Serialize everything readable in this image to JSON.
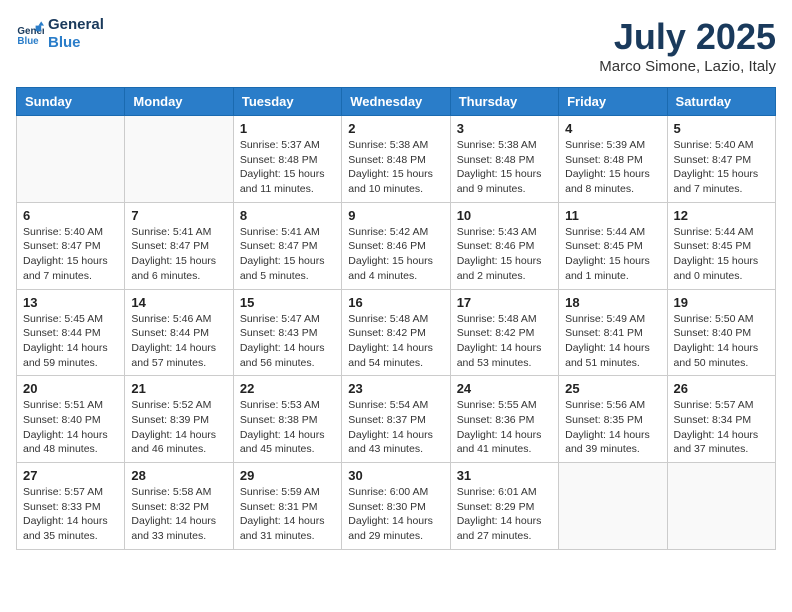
{
  "logo": {
    "text_general": "General",
    "text_blue": "Blue"
  },
  "title": "July 2025",
  "subtitle": "Marco Simone, Lazio, Italy",
  "days_of_week": [
    "Sunday",
    "Monday",
    "Tuesday",
    "Wednesday",
    "Thursday",
    "Friday",
    "Saturday"
  ],
  "weeks": [
    [
      {
        "day": "",
        "info": ""
      },
      {
        "day": "",
        "info": ""
      },
      {
        "day": "1",
        "info": "Sunrise: 5:37 AM\nSunset: 8:48 PM\nDaylight: 15 hours and 11 minutes."
      },
      {
        "day": "2",
        "info": "Sunrise: 5:38 AM\nSunset: 8:48 PM\nDaylight: 15 hours and 10 minutes."
      },
      {
        "day": "3",
        "info": "Sunrise: 5:38 AM\nSunset: 8:48 PM\nDaylight: 15 hours and 9 minutes."
      },
      {
        "day": "4",
        "info": "Sunrise: 5:39 AM\nSunset: 8:48 PM\nDaylight: 15 hours and 8 minutes."
      },
      {
        "day": "5",
        "info": "Sunrise: 5:40 AM\nSunset: 8:47 PM\nDaylight: 15 hours and 7 minutes."
      }
    ],
    [
      {
        "day": "6",
        "info": "Sunrise: 5:40 AM\nSunset: 8:47 PM\nDaylight: 15 hours and 7 minutes."
      },
      {
        "day": "7",
        "info": "Sunrise: 5:41 AM\nSunset: 8:47 PM\nDaylight: 15 hours and 6 minutes."
      },
      {
        "day": "8",
        "info": "Sunrise: 5:41 AM\nSunset: 8:47 PM\nDaylight: 15 hours and 5 minutes."
      },
      {
        "day": "9",
        "info": "Sunrise: 5:42 AM\nSunset: 8:46 PM\nDaylight: 15 hours and 4 minutes."
      },
      {
        "day": "10",
        "info": "Sunrise: 5:43 AM\nSunset: 8:46 PM\nDaylight: 15 hours and 2 minutes."
      },
      {
        "day": "11",
        "info": "Sunrise: 5:44 AM\nSunset: 8:45 PM\nDaylight: 15 hours and 1 minute."
      },
      {
        "day": "12",
        "info": "Sunrise: 5:44 AM\nSunset: 8:45 PM\nDaylight: 15 hours and 0 minutes."
      }
    ],
    [
      {
        "day": "13",
        "info": "Sunrise: 5:45 AM\nSunset: 8:44 PM\nDaylight: 14 hours and 59 minutes."
      },
      {
        "day": "14",
        "info": "Sunrise: 5:46 AM\nSunset: 8:44 PM\nDaylight: 14 hours and 57 minutes."
      },
      {
        "day": "15",
        "info": "Sunrise: 5:47 AM\nSunset: 8:43 PM\nDaylight: 14 hours and 56 minutes."
      },
      {
        "day": "16",
        "info": "Sunrise: 5:48 AM\nSunset: 8:42 PM\nDaylight: 14 hours and 54 minutes."
      },
      {
        "day": "17",
        "info": "Sunrise: 5:48 AM\nSunset: 8:42 PM\nDaylight: 14 hours and 53 minutes."
      },
      {
        "day": "18",
        "info": "Sunrise: 5:49 AM\nSunset: 8:41 PM\nDaylight: 14 hours and 51 minutes."
      },
      {
        "day": "19",
        "info": "Sunrise: 5:50 AM\nSunset: 8:40 PM\nDaylight: 14 hours and 50 minutes."
      }
    ],
    [
      {
        "day": "20",
        "info": "Sunrise: 5:51 AM\nSunset: 8:40 PM\nDaylight: 14 hours and 48 minutes."
      },
      {
        "day": "21",
        "info": "Sunrise: 5:52 AM\nSunset: 8:39 PM\nDaylight: 14 hours and 46 minutes."
      },
      {
        "day": "22",
        "info": "Sunrise: 5:53 AM\nSunset: 8:38 PM\nDaylight: 14 hours and 45 minutes."
      },
      {
        "day": "23",
        "info": "Sunrise: 5:54 AM\nSunset: 8:37 PM\nDaylight: 14 hours and 43 minutes."
      },
      {
        "day": "24",
        "info": "Sunrise: 5:55 AM\nSunset: 8:36 PM\nDaylight: 14 hours and 41 minutes."
      },
      {
        "day": "25",
        "info": "Sunrise: 5:56 AM\nSunset: 8:35 PM\nDaylight: 14 hours and 39 minutes."
      },
      {
        "day": "26",
        "info": "Sunrise: 5:57 AM\nSunset: 8:34 PM\nDaylight: 14 hours and 37 minutes."
      }
    ],
    [
      {
        "day": "27",
        "info": "Sunrise: 5:57 AM\nSunset: 8:33 PM\nDaylight: 14 hours and 35 minutes."
      },
      {
        "day": "28",
        "info": "Sunrise: 5:58 AM\nSunset: 8:32 PM\nDaylight: 14 hours and 33 minutes."
      },
      {
        "day": "29",
        "info": "Sunrise: 5:59 AM\nSunset: 8:31 PM\nDaylight: 14 hours and 31 minutes."
      },
      {
        "day": "30",
        "info": "Sunrise: 6:00 AM\nSunset: 8:30 PM\nDaylight: 14 hours and 29 minutes."
      },
      {
        "day": "31",
        "info": "Sunrise: 6:01 AM\nSunset: 8:29 PM\nDaylight: 14 hours and 27 minutes."
      },
      {
        "day": "",
        "info": ""
      },
      {
        "day": "",
        "info": ""
      }
    ]
  ]
}
